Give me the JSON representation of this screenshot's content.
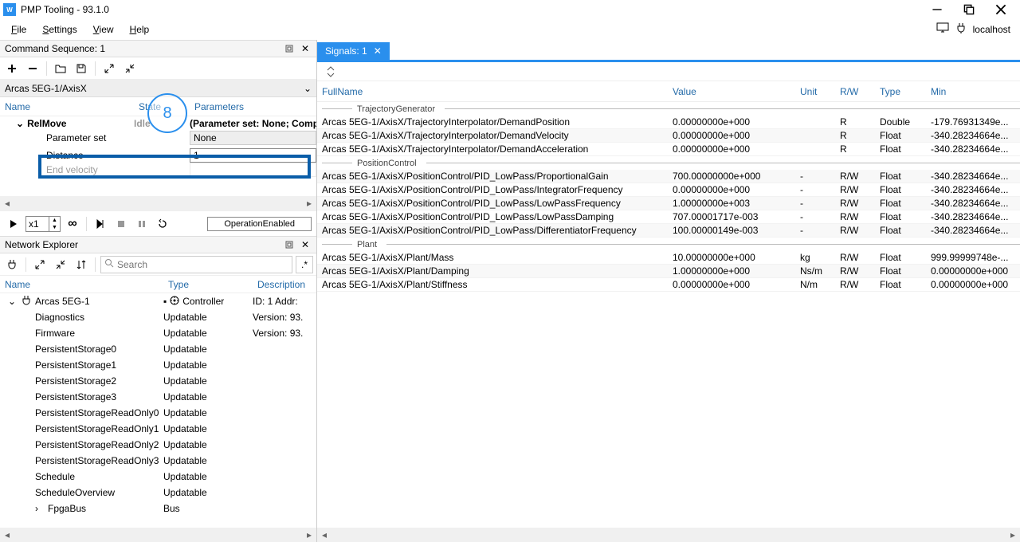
{
  "titlebar": {
    "title": "PMP Tooling - 93.1.0"
  },
  "menu": {
    "file": "File",
    "settings": "Settings",
    "view": "View",
    "help": "Help",
    "host": "localhost"
  },
  "cmd_panel": {
    "title": "Command Sequence: 1",
    "breadcrumb": "Arcas 5EG-1/AxisX",
    "head_name": "Name",
    "head_state": "State",
    "head_params": "Parameters",
    "relmove": "RelMove",
    "relmove_state": "Idle",
    "relmove_params": "(Parameter set: None; Complet",
    "param_set": "Parameter set",
    "param_set_val": "None",
    "distance": "Distance",
    "distance_val": "1",
    "end_velocity": "End velocity",
    "speed": "x1",
    "op_enabled": "OperationEnabled"
  },
  "callout": "8",
  "net_panel": {
    "title": "Network Explorer",
    "search_placeholder": "Search",
    "head_name": "Name",
    "head_type": "Type",
    "head_desc": "Description",
    "rows": [
      {
        "name": "Arcas 5EG-1",
        "type": "Controller",
        "desc": "ID: 1 Addr:",
        "indent": 0,
        "expander": true,
        "has_icons": true
      },
      {
        "name": "Diagnostics",
        "type": "Updatable",
        "desc": "Version: 93.",
        "indent": 1
      },
      {
        "name": "Firmware",
        "type": "Updatable",
        "desc": "Version: 93.",
        "indent": 1
      },
      {
        "name": "PersistentStorage0",
        "type": "Updatable",
        "desc": "",
        "indent": 1
      },
      {
        "name": "PersistentStorage1",
        "type": "Updatable",
        "desc": "",
        "indent": 1
      },
      {
        "name": "PersistentStorage2",
        "type": "Updatable",
        "desc": "",
        "indent": 1
      },
      {
        "name": "PersistentStorage3",
        "type": "Updatable",
        "desc": "",
        "indent": 1
      },
      {
        "name": "PersistentStorageReadOnly0",
        "type": "Updatable",
        "desc": "",
        "indent": 1
      },
      {
        "name": "PersistentStorageReadOnly1",
        "type": "Updatable",
        "desc": "",
        "indent": 1
      },
      {
        "name": "PersistentStorageReadOnly2",
        "type": "Updatable",
        "desc": "",
        "indent": 1
      },
      {
        "name": "PersistentStorageReadOnly3",
        "type": "Updatable",
        "desc": "",
        "indent": 1
      },
      {
        "name": "Schedule",
        "type": "Updatable",
        "desc": "",
        "indent": 1
      },
      {
        "name": "ScheduleOverview",
        "type": "Updatable",
        "desc": "",
        "indent": 1
      },
      {
        "name": "FpgaBus",
        "type": "Bus",
        "desc": "",
        "indent": 1,
        "expander": true,
        "collapsed": true
      }
    ]
  },
  "signals": {
    "tab": "Signals: 1",
    "head": {
      "name": "FullName",
      "value": "Value",
      "unit": "Unit",
      "rw": "R/W",
      "type": "Type",
      "min": "Min"
    },
    "groups": [
      {
        "label": "TrajectoryGenerator",
        "rows": [
          {
            "name": "Arcas 5EG-1/AxisX/TrajectoryInterpolator/DemandPosition",
            "val": "0.00000000e+000",
            "unit": "",
            "rw": "R",
            "type": "Double",
            "min": "-179.76931349e..."
          },
          {
            "name": "Arcas 5EG-1/AxisX/TrajectoryInterpolator/DemandVelocity",
            "val": "0.00000000e+000",
            "unit": "",
            "rw": "R",
            "type": "Float",
            "min": "-340.28234664e..."
          },
          {
            "name": "Arcas 5EG-1/AxisX/TrajectoryInterpolator/DemandAcceleration",
            "val": "0.00000000e+000",
            "unit": "",
            "rw": "R",
            "type": "Float",
            "min": "-340.28234664e..."
          }
        ]
      },
      {
        "label": "PositionControl",
        "rows": [
          {
            "name": "Arcas 5EG-1/AxisX/PositionControl/PID_LowPass/ProportionalGain",
            "val": "700.00000000e+000",
            "unit": "-",
            "rw": "R/W",
            "type": "Float",
            "min": "-340.28234664e..."
          },
          {
            "name": "Arcas 5EG-1/AxisX/PositionControl/PID_LowPass/IntegratorFrequency",
            "val": "0.00000000e+000",
            "unit": "-",
            "rw": "R/W",
            "type": "Float",
            "min": "-340.28234664e..."
          },
          {
            "name": "Arcas 5EG-1/AxisX/PositionControl/PID_LowPass/LowPassFrequency",
            "val": "1.00000000e+003",
            "unit": "-",
            "rw": "R/W",
            "type": "Float",
            "min": "-340.28234664e..."
          },
          {
            "name": "Arcas 5EG-1/AxisX/PositionControl/PID_LowPass/LowPassDamping",
            "val": "707.00001717e-003",
            "unit": "-",
            "rw": "R/W",
            "type": "Float",
            "min": "-340.28234664e..."
          },
          {
            "name": "Arcas 5EG-1/AxisX/PositionControl/PID_LowPass/DifferentiatorFrequency",
            "val": "100.00000149e-003",
            "unit": "-",
            "rw": "R/W",
            "type": "Float",
            "min": "-340.28234664e..."
          }
        ]
      },
      {
        "label": "Plant",
        "rows": [
          {
            "name": "Arcas 5EG-1/AxisX/Plant/Mass",
            "val": "10.00000000e+000",
            "unit": "kg",
            "rw": "R/W",
            "type": "Float",
            "min": "999.99999748e-..."
          },
          {
            "name": "Arcas 5EG-1/AxisX/Plant/Damping",
            "val": "1.00000000e+000",
            "unit": "Ns/m",
            "rw": "R/W",
            "type": "Float",
            "min": "0.00000000e+000"
          },
          {
            "name": "Arcas 5EG-1/AxisX/Plant/Stiffness",
            "val": "0.00000000e+000",
            "unit": "N/m",
            "rw": "R/W",
            "type": "Float",
            "min": "0.00000000e+000"
          }
        ]
      }
    ]
  }
}
